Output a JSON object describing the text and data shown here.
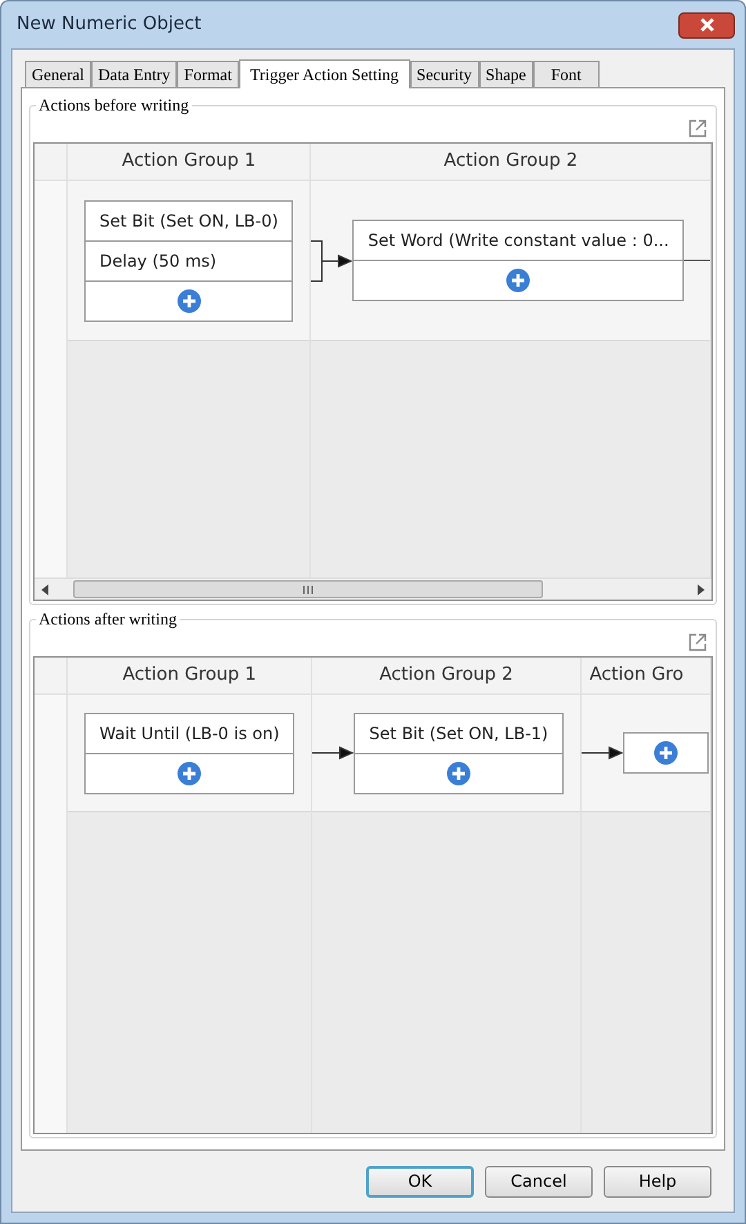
{
  "window": {
    "title": "New Numeric Object"
  },
  "tabs": [
    {
      "label": "General",
      "selected": false
    },
    {
      "label": "Data Entry",
      "selected": false
    },
    {
      "label": "Format",
      "selected": false
    },
    {
      "label": "Trigger Action Setting",
      "selected": true
    },
    {
      "label": "Security",
      "selected": false
    },
    {
      "label": "Shape",
      "selected": false
    },
    {
      "label": "Font",
      "selected": false
    }
  ],
  "sections": [
    {
      "title": "Actions before writing",
      "more_columns": true,
      "scrollbar": true,
      "groups": [
        {
          "header": "Action Group 1",
          "actions": [
            "Set Bit (Set ON, LB-0)",
            "Delay (50 ms)"
          ]
        },
        {
          "header": "Action Group 2",
          "actions": [
            "Set Word (Write constant value : 0..."
          ]
        }
      ]
    },
    {
      "title": "Actions after writing",
      "more_columns": false,
      "scrollbar": false,
      "groups": [
        {
          "header": "Action Group 1",
          "actions": [
            "Wait Until (LB-0 is on)"
          ]
        },
        {
          "header": "Action Group 2",
          "actions": [
            "Set Bit (Set ON, LB-1)"
          ]
        },
        {
          "header": "Action Gro"
        }
      ]
    }
  ],
  "buttons": [
    {
      "label": "OK",
      "default": true
    },
    {
      "label": "Cancel",
      "default": false
    },
    {
      "label": "Help",
      "default": false
    }
  ]
}
